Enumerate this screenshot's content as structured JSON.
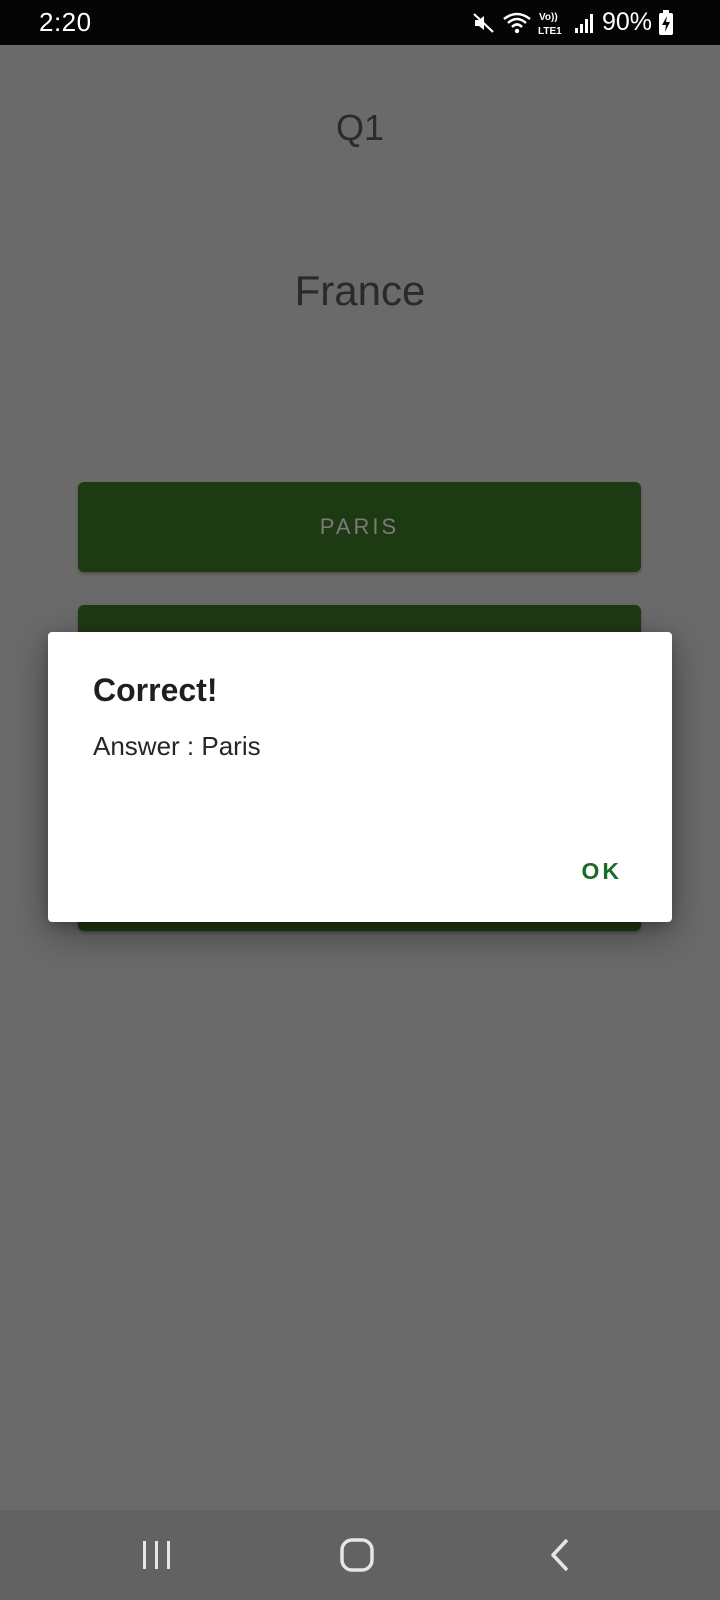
{
  "status_bar": {
    "time": "2:20",
    "battery_percent": "90%",
    "network_label": "Vo)) LTE1",
    "icons": [
      "mute-icon",
      "wifi-icon",
      "volte-lte-icon",
      "signal-icon",
      "battery-charging-icon"
    ]
  },
  "quiz": {
    "question_number": "Q1",
    "country": "France",
    "options": [
      "PARIS"
    ]
  },
  "dialog": {
    "title": "Correct!",
    "message": "Answer : Paris",
    "ok_label": "OK"
  },
  "nav_bar": {
    "icons": [
      "recents-icon",
      "home-icon",
      "back-icon"
    ]
  },
  "colors": {
    "scrim_background": "#6a6a6a",
    "answer_button": "#1e3a13",
    "dialog_accent": "#1c6b28",
    "status_bar": "#050505",
    "nav_bar": "#626262"
  }
}
